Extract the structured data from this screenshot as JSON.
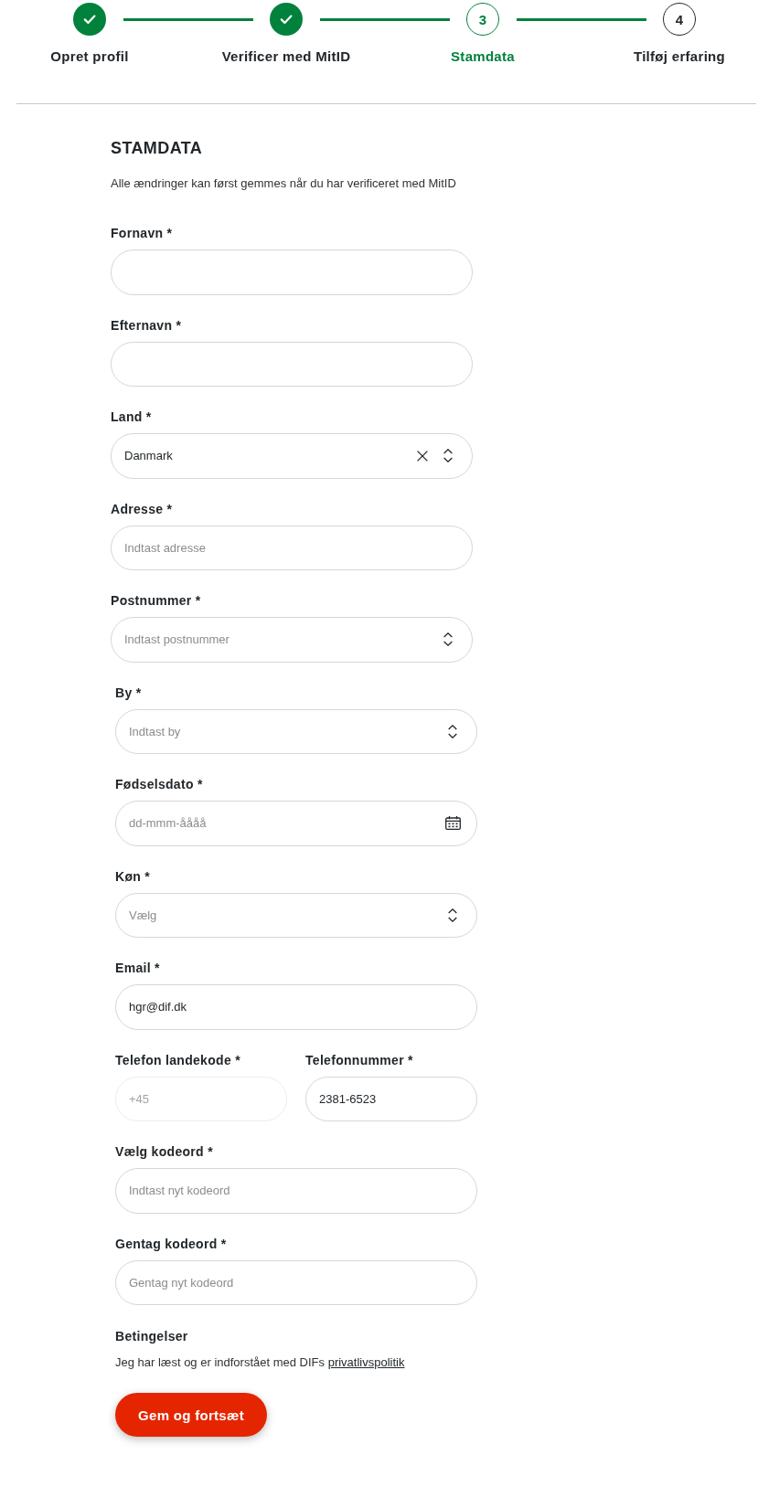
{
  "stepper": {
    "steps": [
      {
        "label": "Opret profil",
        "done": true,
        "current": false
      },
      {
        "label": "Verificer med MitID",
        "done": true,
        "current": false
      },
      {
        "label": "Stamdata",
        "done": false,
        "current": true,
        "number": "3"
      },
      {
        "label": "Tilføj erfaring",
        "done": false,
        "current": false,
        "number": "4"
      }
    ]
  },
  "form": {
    "title": "STAMDATA",
    "note": "Alle ændringer kan først gemmes når du har verificeret med MitID",
    "fields": [
      {
        "kind": "text",
        "label": "Fornavn *",
        "disabled": false
      },
      {
        "kind": "text",
        "label": "Efternavn *",
        "disabled": false
      },
      {
        "kind": "select",
        "label": "Land *",
        "value": "Danmark",
        "clearable": true,
        "disabled": false
      },
      {
        "kind": "text",
        "label": "Adresse *",
        "placeholder": "Indtast adresse",
        "disabled": false
      },
      {
        "kind": "select",
        "label": "Postnummer *",
        "placeholder": "Indtast postnummer",
        "clearable": false,
        "disabled": false
      },
      {
        "kind": "select",
        "label": "By *",
        "placeholder": "Indtast by",
        "clearable": false,
        "disabled": false
      },
      {
        "kind": "date",
        "label": "Fødselsdato *",
        "placeholder": "dd-mmm-åååå",
        "disabled": false
      },
      {
        "kind": "select",
        "label": "Køn *",
        "placeholder": "Vælg",
        "clearable": false,
        "disabled": false
      },
      {
        "kind": "text",
        "label": "Email *",
        "value": "hgr@dif.dk",
        "disabled": false
      },
      {
        "kind": "pair",
        "fields": [
          {
            "kind": "text",
            "label": "Telefon landekode *",
            "value": "+45",
            "disabled": true
          },
          {
            "kind": "text",
            "label": "Telefonnummer *",
            "value": "2381-6523",
            "disabled": false
          }
        ]
      },
      {
        "kind": "text",
        "label": "Vælg kodeord *",
        "placeholder": "Indtast nyt kodeord",
        "disabled": false
      },
      {
        "kind": "text",
        "label": "Gentag kodeord *",
        "placeholder": "Gentag nyt kodeord",
        "disabled": false
      }
    ],
    "terms": {
      "title": "Betingelser",
      "text": "Jeg har læst og er indforstået med DIFs",
      "link": "privatlivspolitik"
    },
    "submit": "Gem og fortsæt"
  }
}
